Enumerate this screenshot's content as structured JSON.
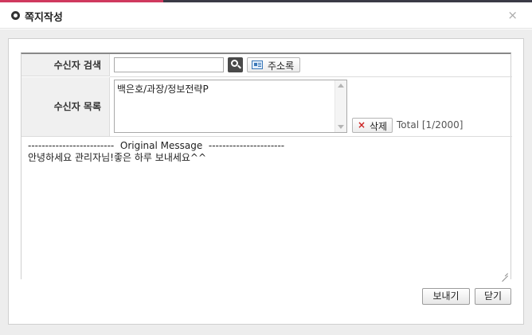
{
  "window": {
    "title": "쪽지작성",
    "close_glyph": "×",
    "accent_color": "#d0395e"
  },
  "recipient_search": {
    "label": "수신자 검색",
    "input_value": "",
    "search_icon": "search-icon",
    "address_book_label": "주소록"
  },
  "recipient_list": {
    "label": "수신자 목록",
    "items": [
      "백은호/과장/정보전략P"
    ],
    "delete_label": "삭제",
    "total_text": "Total [1/2000]"
  },
  "message": {
    "body": "-------------------------  Original Message  ----------------------\n안녕하세요 관리자님!좋은 하루 보내세요^^"
  },
  "actions": {
    "send_label": "보내기",
    "close_label": "닫기"
  }
}
